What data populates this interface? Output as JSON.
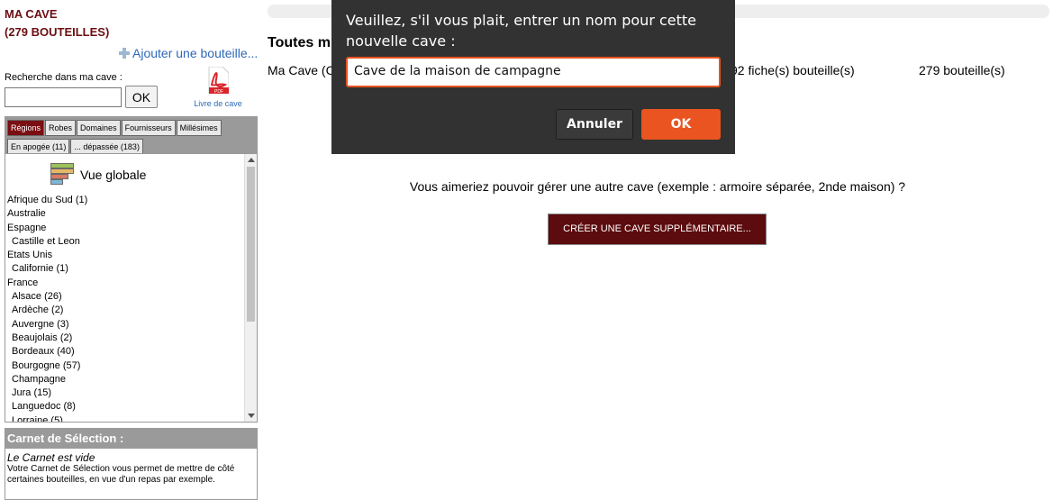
{
  "sidebar": {
    "cave_title": "MA CAVE",
    "bottle_count": "(279 BOUTEILLES)",
    "add_bottle": "Ajouter une bouteille...",
    "search_label": "Recherche dans ma cave :",
    "search_value": "",
    "search_button": "OK",
    "pdf_caption": "Livre de cave",
    "tabs": [
      "Régions",
      "Robes",
      "Domaines",
      "Fournisseurs",
      "Millésimes",
      "En apogée (11)",
      "... dépassée (183)"
    ],
    "vue_globale": "Vue globale",
    "regions": [
      {
        "label": "Afrique du Sud (1)",
        "sub": false
      },
      {
        "label": "Australie",
        "sub": false
      },
      {
        "label": "Espagne",
        "sub": false
      },
      {
        "label": "Castille et Leon",
        "sub": true
      },
      {
        "label": "Etats Unis",
        "sub": false
      },
      {
        "label": "Californie (1)",
        "sub": true
      },
      {
        "label": "France",
        "sub": false
      },
      {
        "label": "Alsace (26)",
        "sub": true
      },
      {
        "label": "Ardèche (2)",
        "sub": true
      },
      {
        "label": "Auvergne (3)",
        "sub": true
      },
      {
        "label": "Beaujolais (2)",
        "sub": true
      },
      {
        "label": "Bordeaux (40)",
        "sub": true
      },
      {
        "label": "Bourgogne (57)",
        "sub": true
      },
      {
        "label": "Champagne",
        "sub": true
      },
      {
        "label": "Jura (15)",
        "sub": true
      },
      {
        "label": "Languedoc (8)",
        "sub": true
      },
      {
        "label": "Lorraine (5)",
        "sub": true
      }
    ],
    "carnet_title": "Carnet de Sélection :",
    "carnet_empty": "Le Carnet est vide",
    "carnet_desc": "Votre Carnet de Sélection vous permet de mettre de côté certaines bouteilles, en vue d'un repas par exemple."
  },
  "main": {
    "heading": "Toutes m",
    "cave_name": "Ma Cave (C",
    "fiches": "92 fiche(s) bouteille(s)",
    "bottles": "279 bouteille(s)",
    "question": "Vous aimeriez pouvoir gérer une autre cave (exemple : armoire séparée, 2nde maison) ?",
    "create_button": "CRÉER UNE CAVE SUPPLÉMENTAIRE..."
  },
  "dialog": {
    "message": "Veuillez, s'il vous plait, entrer un nom pour cette nouvelle cave :",
    "input_value": "Cave de la maison de campagne",
    "cancel_label": "Annuler",
    "ok_label": "OK"
  },
  "colors": {
    "brand_dark_red": "#6b0f12",
    "button_dark_red": "#5c0b0e",
    "dialog_accent": "#e95420",
    "link_blue": "#2d68b8"
  }
}
